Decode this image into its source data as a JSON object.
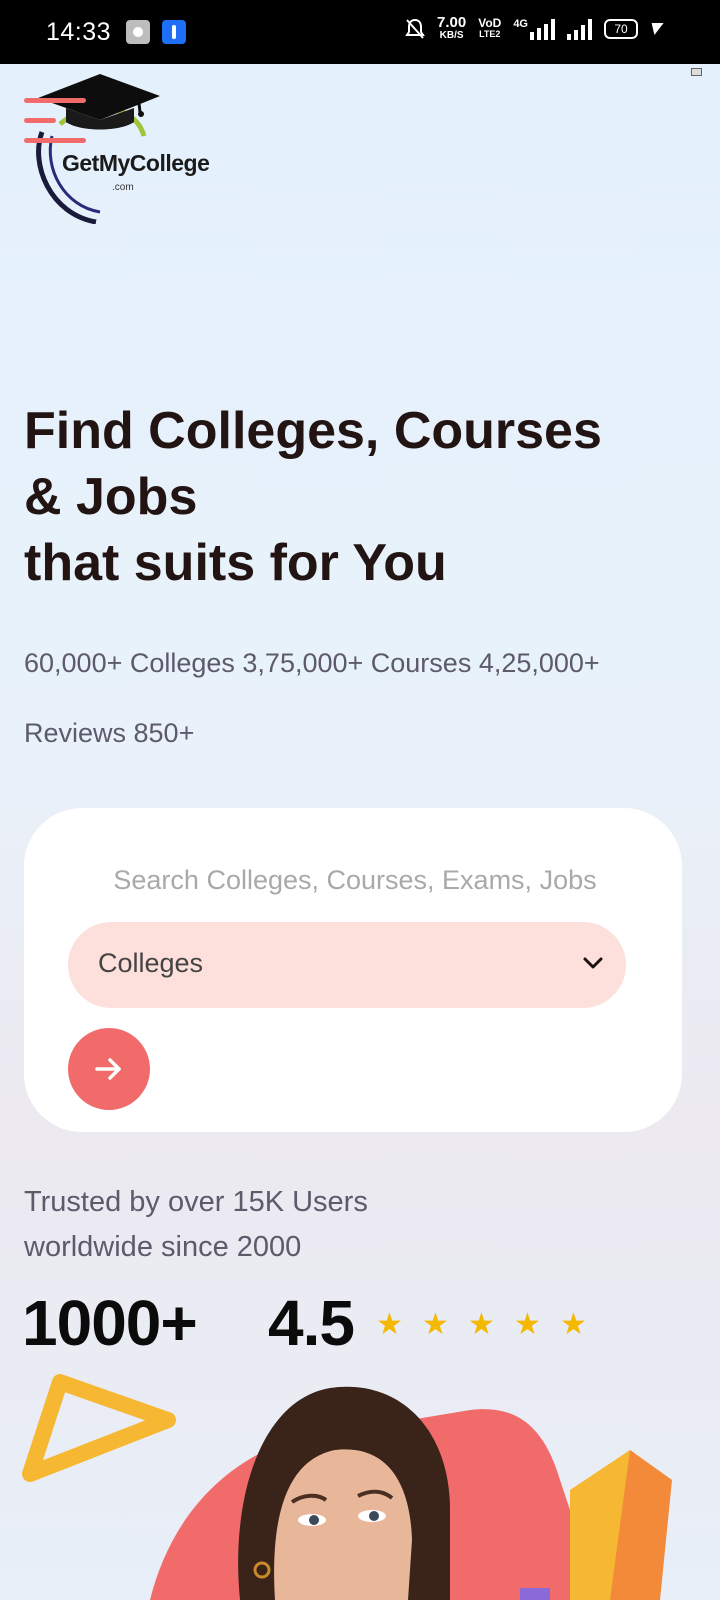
{
  "status_bar": {
    "time": "14:33",
    "net_speed_value": "7.00",
    "net_speed_unit": "KB/S",
    "volte_top": "VoD",
    "volte_bottom": "LTE2",
    "network_type": "4G",
    "battery_level": "70"
  },
  "header": {
    "logo_name": "GetMyCollege",
    "logo_domain": ".com",
    "menu_icon": "hamburger-icon"
  },
  "hero": {
    "title_line1": "Find Colleges, Courses",
    "title_line2": "& Jobs",
    "title_line3": "that suits for You",
    "stats": "60,000+ Colleges 3,75,000+ Courses 4,25,000+ Reviews 850+"
  },
  "search": {
    "placeholder": "Search Colleges, Courses, Exams, Jobs",
    "category_selected": "Colleges",
    "go_icon": "arrow-right-icon"
  },
  "trust": {
    "text_line1": "Trusted by over 15K Users",
    "text_line2": "worldwide since 2000",
    "users_count": "1000+",
    "rating_value": "4.5",
    "star_count": 5
  },
  "colors": {
    "accent": "#f26b6b",
    "select_bg": "#fde0db",
    "star": "#f5b800",
    "heading": "#231414",
    "muted_text": "#5d5a6b"
  }
}
